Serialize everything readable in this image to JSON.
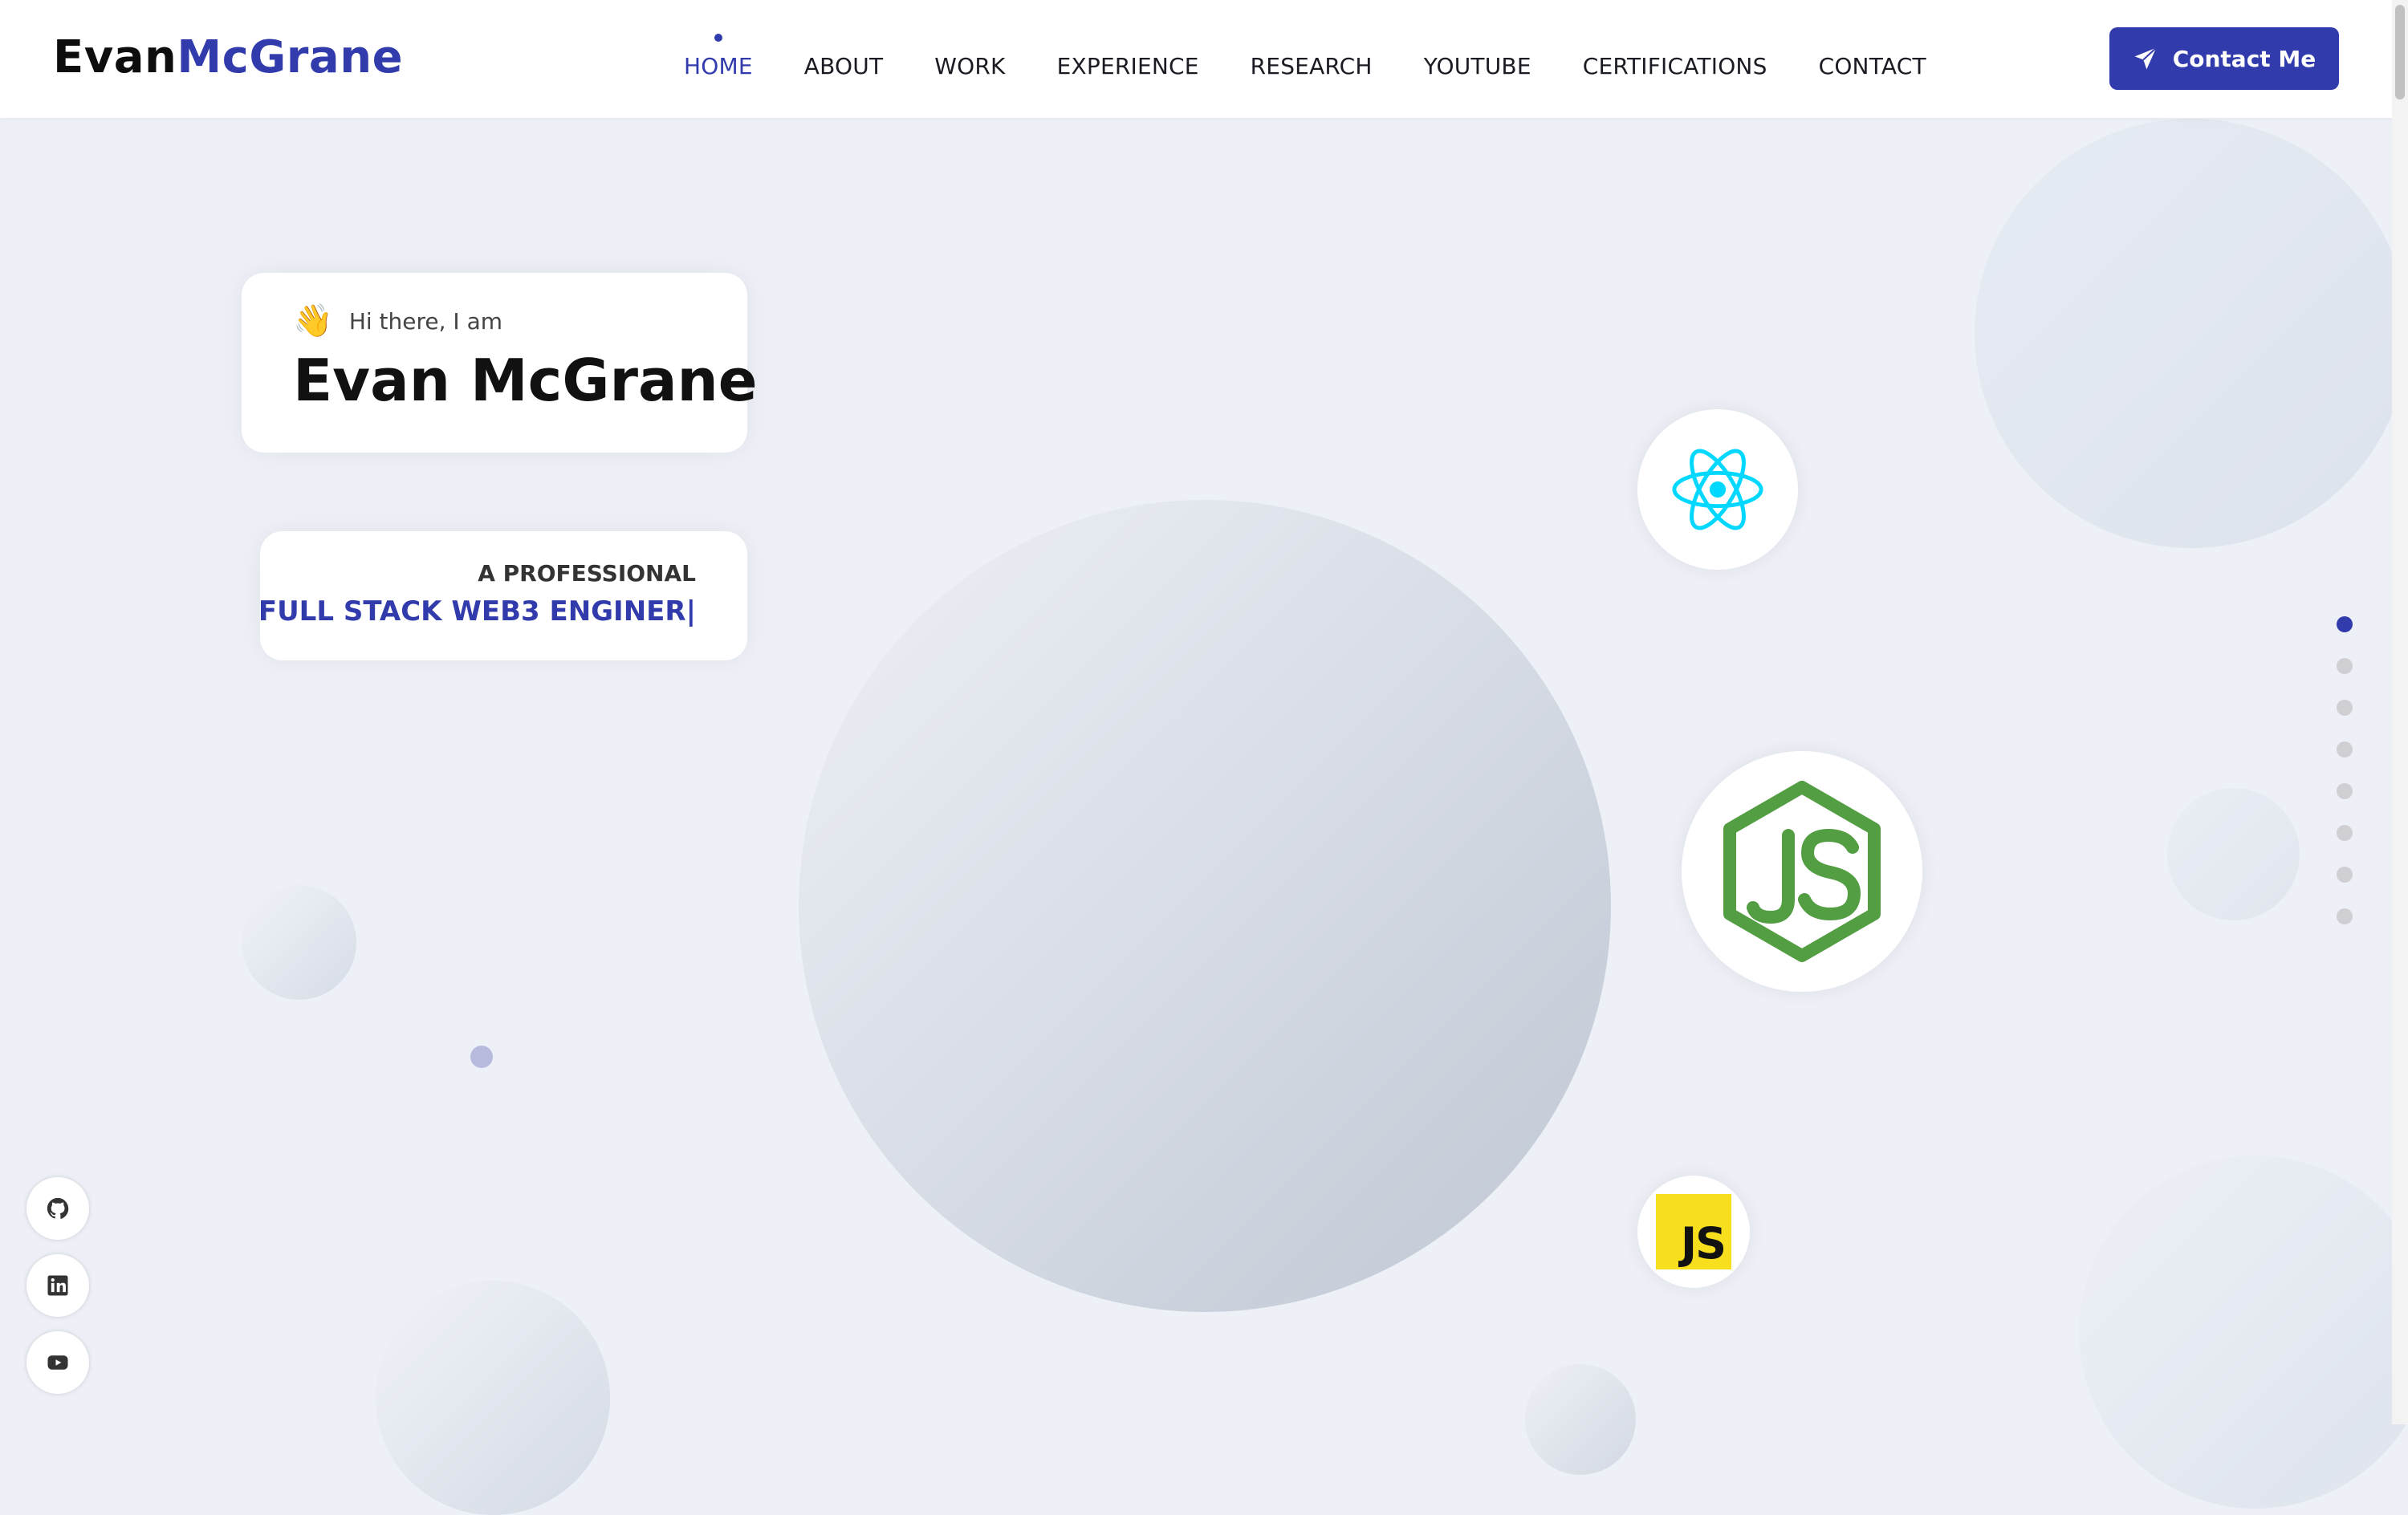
{
  "logo": {
    "first": "Evan",
    "last": "McGrane"
  },
  "nav": {
    "items": [
      {
        "label": "HOME",
        "active": true
      },
      {
        "label": "ABOUT"
      },
      {
        "label": "WORK"
      },
      {
        "label": "EXPERIENCE"
      },
      {
        "label": "RESEARCH"
      },
      {
        "label": "YOUTUBE"
      },
      {
        "label": "CERTIFICATIONS"
      },
      {
        "label": "CONTACT"
      }
    ],
    "cta_label": "Contact Me",
    "cta_icon": "paper-plane-icon"
  },
  "hero": {
    "greeting": "Hi there, I am",
    "greeting_emoji": "👋",
    "name": "Evan McGrane",
    "role_prefix": "A PROFESSIONAL",
    "role_title": "FULL STACK WEB3 ENGINER|"
  },
  "tech_icons": [
    "react-icon",
    "nodejs-icon",
    "javascript-icon"
  ],
  "social": [
    "github-icon",
    "linkedin-icon",
    "youtube-icon"
  ],
  "section_dots": {
    "count": 8,
    "active_index": 0
  },
  "colors": {
    "accent": "#313bac",
    "background": "#edf1f7",
    "react": "#00d8ff",
    "node": "#539e43",
    "js": "#f7df1e"
  }
}
